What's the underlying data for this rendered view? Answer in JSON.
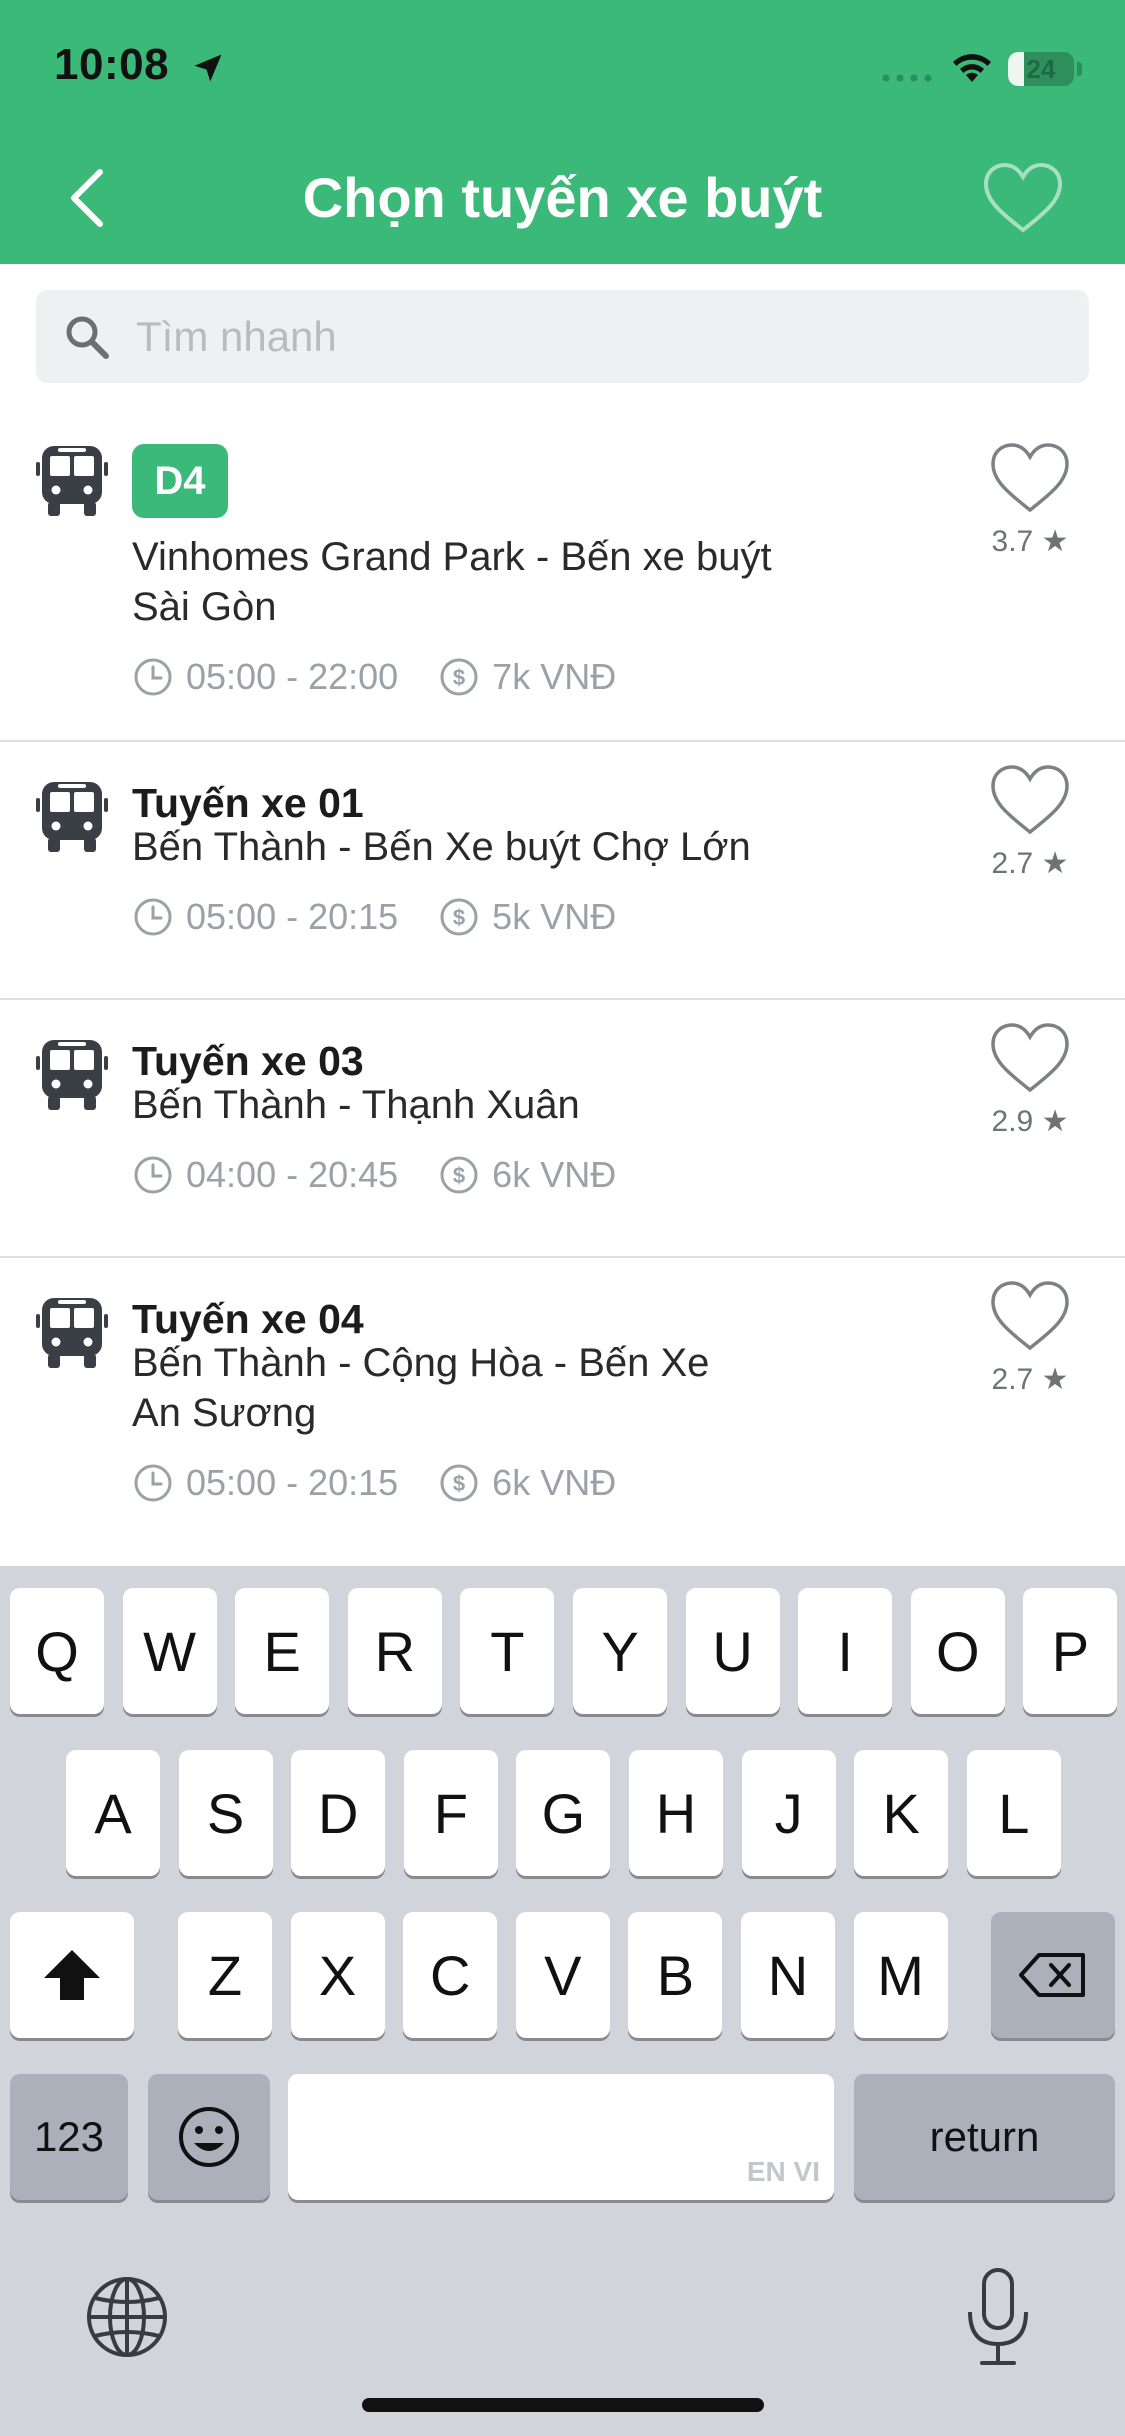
{
  "status_bar": {
    "time": "10:08",
    "battery": "24",
    "battery_level": 0.24,
    "icons": [
      "location-arrow-icon",
      "cellular-signal-icon",
      "wifi-icon",
      "battery-charging-icon"
    ]
  },
  "header": {
    "title": "Chọn tuyến xe buýt",
    "back_icon": "chevron-left-icon",
    "favorite_icon": "heart-outline-icon",
    "background": "#3bb978"
  },
  "search": {
    "placeholder": "Tìm nhanh",
    "value": "",
    "icon": "search-icon"
  },
  "routes": [
    {
      "badge": "D4",
      "name": "",
      "description_lines": [
        "Vinhomes Grand Park - Bến xe buýt",
        "Sài Gòn"
      ],
      "hours": "05:00 - 22:00",
      "fare": "7k VNĐ",
      "rating": "3.7 ★"
    },
    {
      "badge": "",
      "name": "Tuyến xe 01",
      "description_lines": [
        "Bến Thành - Bến Xe buýt Chợ Lớn"
      ],
      "hours": "05:00 - 20:15",
      "fare": "5k VNĐ",
      "rating": "2.7 ★"
    },
    {
      "badge": "",
      "name": "Tuyến xe 03",
      "description_lines": [
        "Bến Thành - Thạnh Xuân"
      ],
      "hours": "04:00 - 20:45",
      "fare": "6k VNĐ",
      "rating": "2.9 ★"
    },
    {
      "badge": "",
      "name": "Tuyến xe 04",
      "description_lines": [
        "Bến Thành - Cộng Hòa - Bến Xe",
        "An Sương"
      ],
      "hours": "05:00 - 20:15",
      "fare": "6k VNĐ",
      "rating": "2.7 ★"
    }
  ],
  "keyboard": {
    "row1": [
      "Q",
      "W",
      "E",
      "R",
      "T",
      "Y",
      "U",
      "I",
      "O",
      "P"
    ],
    "row2": [
      "A",
      "S",
      "D",
      "F",
      "G",
      "H",
      "J",
      "K",
      "L"
    ],
    "row3": [
      "Z",
      "X",
      "C",
      "V",
      "B",
      "N",
      "M"
    ],
    "numbers_label": "123",
    "return_label": "return",
    "space_hint": "EN VI",
    "icons": [
      "shift-icon",
      "backspace-icon",
      "emoji-icon",
      "globe-icon",
      "microphone-icon"
    ]
  },
  "colors": {
    "accent": "#3bb978",
    "muted_text": "#9ba1a6",
    "keyboard_bg": "#d1d4da"
  }
}
